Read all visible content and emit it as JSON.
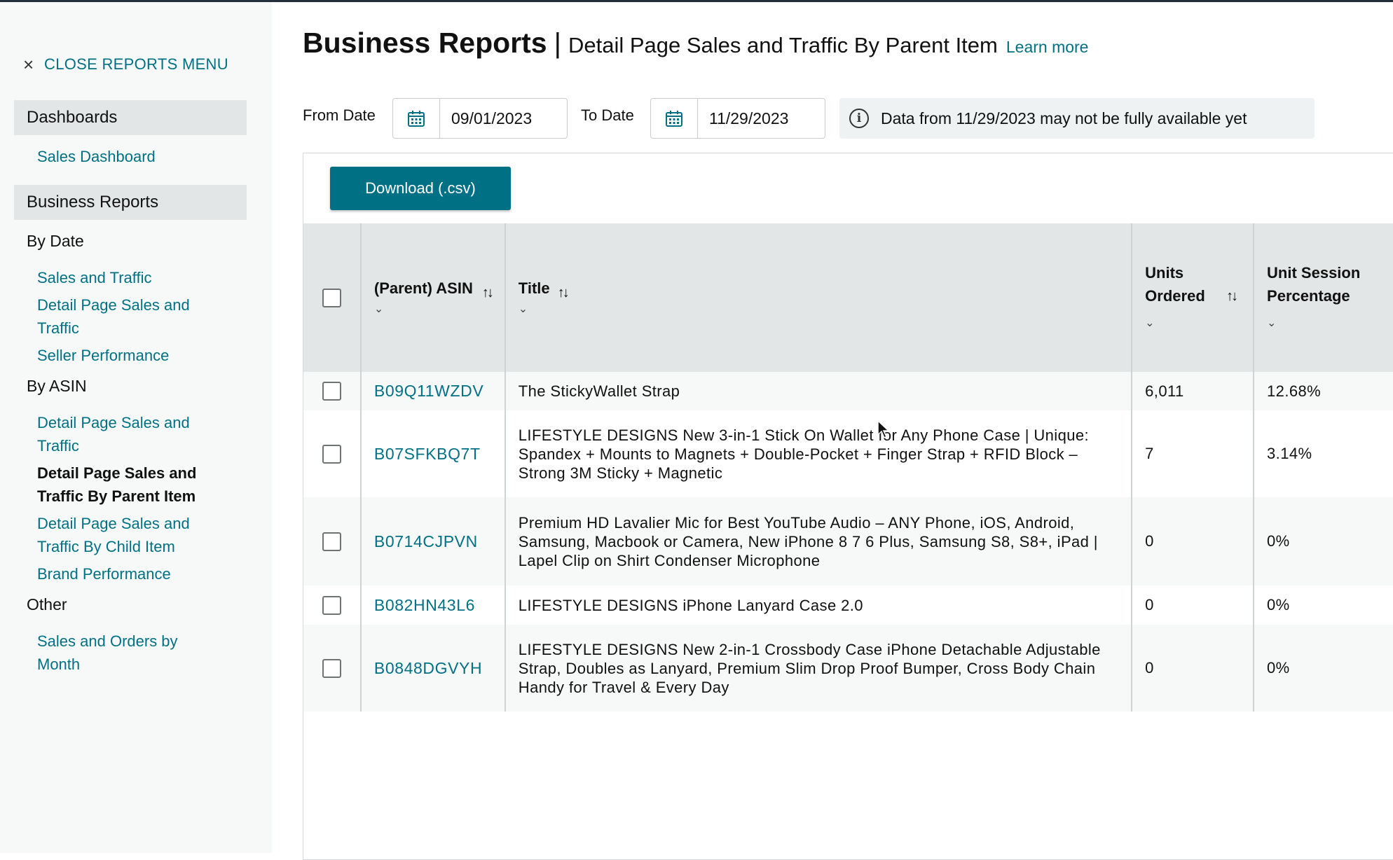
{
  "sidebar": {
    "close_label": "CLOSE REPORTS MENU",
    "dashboards_header": "Dashboards",
    "sales_dashboard": "Sales Dashboard",
    "business_reports_header": "Business Reports",
    "by_date_label": "By Date",
    "by_date_items": [
      "Sales and Traffic",
      "Detail Page Sales and Traffic",
      "Seller Performance"
    ],
    "by_asin_label": "By ASIN",
    "by_asin_items": [
      "Detail Page Sales and Traffic",
      "Detail Page Sales and Traffic By Parent Item",
      "Detail Page Sales and Traffic By Child Item",
      "Brand Performance"
    ],
    "active_item": "Detail Page Sales and Traffic By Parent Item",
    "other_label": "Other",
    "other_items": [
      "Sales and Orders by Month"
    ]
  },
  "header": {
    "title": "Business Reports",
    "separator": "|",
    "subtitle": "Detail Page Sales and Traffic By Parent Item",
    "learn_more": "Learn more"
  },
  "filters": {
    "from_label": "From Date",
    "from_value": "09/01/2023",
    "to_label": "To Date",
    "to_value": "11/29/2023",
    "notice": "Data from 11/29/2023 may not be fully available yet"
  },
  "download_label": "Download (.csv)",
  "table": {
    "columns": [
      "(Parent) ASIN",
      "Title",
      "Units Ordered",
      "Unit Session Percentage"
    ],
    "rows": [
      {
        "asin": "B09Q11WZDV",
        "title": "The StickyWallet Strap",
        "units": "6,011",
        "usp": "12.68%"
      },
      {
        "asin": "B07SFKBQ7T",
        "title": "LIFESTYLE DESIGNS New 3-in-1 Stick On Wallet for Any Phone Case | Unique: Spandex + Mounts to Magnets + Double-Pocket + Finger Strap + RFID Block – Strong 3M Sticky + Magnetic",
        "units": "7",
        "usp": "3.14%"
      },
      {
        "asin": "B0714CJPVN",
        "title": "Premium HD Lavalier Mic for Best YouTube Audio – ANY Phone, iOS, Android, Samsung, Macbook or Camera, New iPhone 8 7 6 Plus, Samsung S8, S8+, iPad | Lapel Clip on Shirt Condenser Microphone",
        "units": "0",
        "usp": "0%"
      },
      {
        "asin": "B082HN43L6",
        "title": "LIFESTYLE DESIGNS iPhone Lanyard Case 2.0",
        "units": "0",
        "usp": "0%"
      },
      {
        "asin": "B0848DGVYH",
        "title": "LIFESTYLE DESIGNS New 2-in-1 Crossbody Case iPhone Detachable Adjustable Strap, Doubles as Lanyard, Premium Slim Drop Proof Bumper, Cross Body Chain Handy for Travel & Every Day",
        "units": "0",
        "usp": "0%"
      }
    ]
  },
  "icons": {
    "close": "close-icon",
    "calendar": "calendar-icon",
    "info": "info-icon",
    "sort": "sort-icon",
    "chevron": "chevron-down-icon"
  },
  "colors": {
    "link": "#007185",
    "button": "#007185",
    "header_bg": "#e3e6e6",
    "sidebar_bg": "#f7f8f8"
  }
}
